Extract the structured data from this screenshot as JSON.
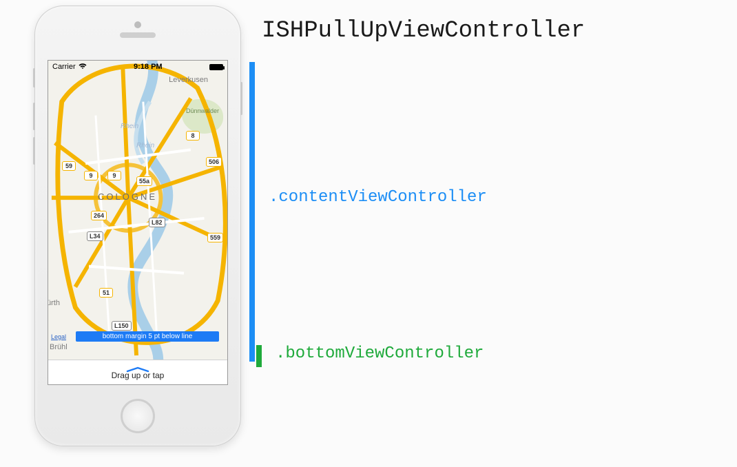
{
  "title": "ISHPullUpViewController",
  "annotations": {
    "content": ".contentViewController",
    "bottom": ".bottomViewController"
  },
  "statusbar": {
    "carrier": "Carrier",
    "time": "9:18 PM"
  },
  "map": {
    "city": "Cologne",
    "towns": {
      "leverkusen": "Leverkusen",
      "park": "Dünnwalder",
      "furth": "ürth",
      "bruhl": "Brühl"
    },
    "river": "Rhein",
    "shields": {
      "s59": "59",
      "s9a": "9",
      "s9b": "9",
      "s8": "8",
      "s506": "506",
      "s55a": "55a",
      "s264": "264",
      "s34": "L34",
      "s82": "L82",
      "s559": "559",
      "s51": "51",
      "s150": "L150"
    },
    "legal": "Legal",
    "bottom_margin": "bottom margin 5 pt below line"
  },
  "dragbar": {
    "text": "Drag up or tap"
  }
}
